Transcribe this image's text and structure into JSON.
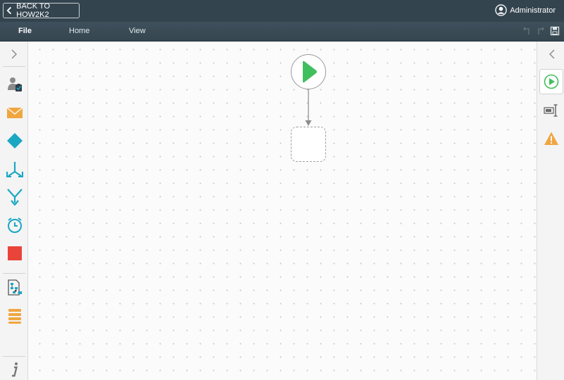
{
  "header": {
    "back_label": "BACK TO HOW2K2",
    "user_name": "Administrator"
  },
  "menu": {
    "tabs": [
      {
        "label": "File",
        "active": true
      },
      {
        "label": "Home",
        "active": false
      },
      {
        "label": "View",
        "active": false
      }
    ]
  },
  "left_toolbox": {
    "tools": [
      "user-task-icon",
      "email-icon",
      "decision-icon",
      "split-icon",
      "merge-icon",
      "timer-icon",
      "end-icon",
      "workflow-reference-icon",
      "data-fields-icon"
    ],
    "info_icon": "info-icon"
  },
  "canvas": {
    "nodes": [
      "start-node",
      "empty-step-placeholder"
    ]
  },
  "right_panel": {
    "tools": [
      "start-properties-icon",
      "field-properties-icon",
      "warning-icon"
    ]
  },
  "colors": {
    "header": "#34444f",
    "start_green": "#3fbf5e",
    "teal": "#1aa7c4",
    "orange": "#f0a640",
    "red": "#e9443a"
  }
}
